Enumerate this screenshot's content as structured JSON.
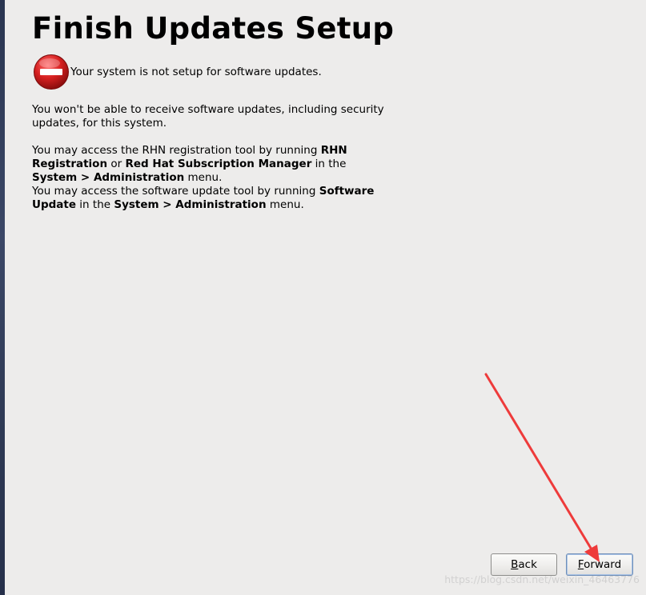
{
  "page": {
    "title": "Finish Updates Setup",
    "status_text": "Your system is not setup for software updates.",
    "paragraph1": "You won't be able to receive software updates, including security updates, for this system.",
    "paragraph2": {
      "t1": "You may access the RHN registration tool by running ",
      "b1": "RHN Registration",
      "t2": " or ",
      "b2": "Red Hat Subscription Manager",
      "t3": " in the ",
      "b3": "System > Administration",
      "t4": " menu."
    },
    "paragraph3": {
      "t1": "You may access the software update tool by running ",
      "b1": "Software Update",
      "t2": " in the ",
      "b2": "System > Administration",
      "t3": " menu."
    }
  },
  "buttons": {
    "back_mnemonic": "B",
    "back_rest": "ack",
    "forward_mnemonic": "F",
    "forward_rest": "orward"
  },
  "watermark": "https://blog.csdn.net/weixin_46463776",
  "colors": {
    "background": "#edeceb",
    "stop_icon": "#d62020",
    "annotation_arrow": "#ee3b3b"
  },
  "icons": {
    "status": "stop-icon"
  }
}
